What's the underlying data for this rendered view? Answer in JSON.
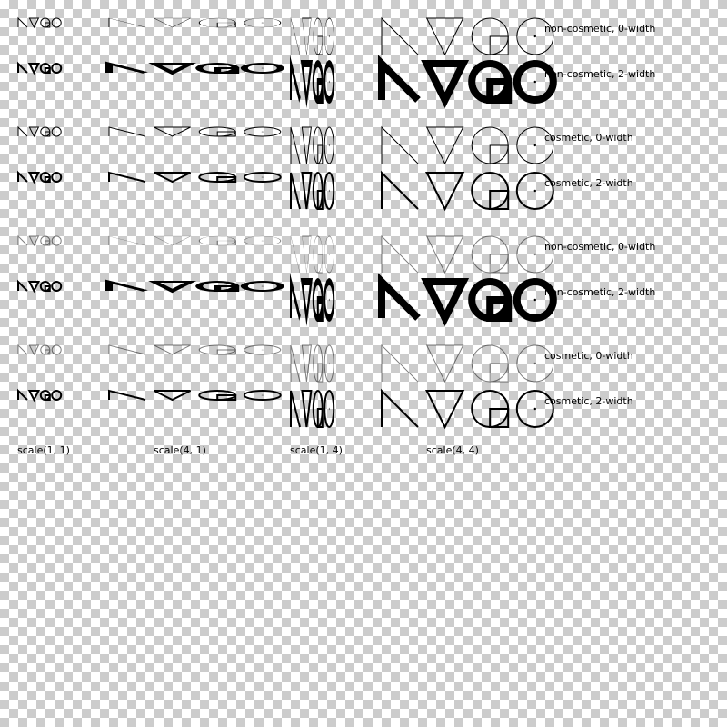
{
  "columns": [
    {
      "label": "scale(1, 1)",
      "sx": 1,
      "sy": 1
    },
    {
      "label": "scale(4, 1)",
      "sx": 4,
      "sy": 1
    },
    {
      "label": "scale(1, 4)",
      "sx": 1,
      "sy": 4
    },
    {
      "label": "scale(4, 4)",
      "sx": 4,
      "sy": 4
    }
  ],
  "rows": [
    {
      "label": "non-cosmetic, 0-width",
      "cosmetic": false,
      "width": 0,
      "opacity": 1
    },
    {
      "label": "non-cosmetic, 2-width",
      "cosmetic": false,
      "width": 2,
      "opacity": 1
    },
    {
      "label": "cosmetic, 0-width",
      "cosmetic": true,
      "width": 0,
      "opacity": 1
    },
    {
      "label": "cosmetic, 2-width",
      "cosmetic": true,
      "width": 2,
      "opacity": 1
    },
    {
      "label": "non-cosmetic, 0-width",
      "cosmetic": false,
      "width": 0,
      "opacity": 0.5
    },
    {
      "label": "non-cosmetic, 2-width",
      "cosmetic": false,
      "width": 2,
      "opacity": 1
    },
    {
      "label": "cosmetic, 0-width",
      "cosmetic": true,
      "width": 0,
      "opacity": 0.5
    },
    {
      "label": "cosmetic, 2-width",
      "cosmetic": true,
      "width": 2,
      "opacity": 1
    }
  ],
  "shapes": [
    "line",
    "triangle",
    "ellipse-with-square",
    "ellipse-with-dot"
  ],
  "colors": {
    "stroke": "#000000",
    "checker_dark": "#cccccc",
    "checker_light": "#ffffff"
  }
}
